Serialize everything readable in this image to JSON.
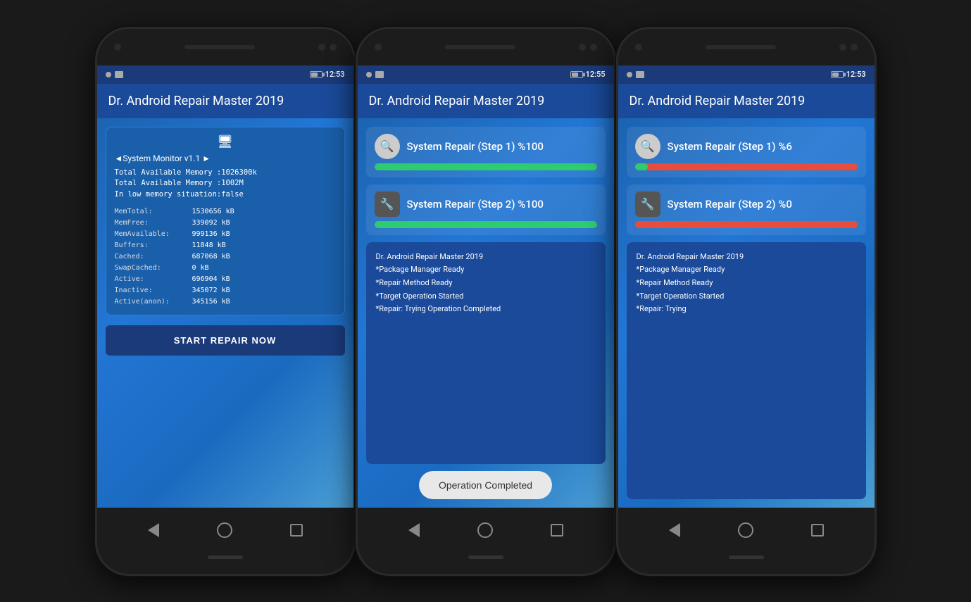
{
  "phones": [
    {
      "id": "phone1",
      "status_bar": {
        "time": "12:53"
      },
      "header": {
        "title": "Dr. Android Repair Master 2019"
      },
      "screen": "monitor",
      "monitor": {
        "nav_label": "◄System Monitor v1.1 ►",
        "summary": [
          "Total Available Memory :1026300k",
          "Total Available Memory :1002M",
          "In low memory situation:false"
        ],
        "rows": [
          {
            "label": "MemTotal:",
            "value": "1530656 kB"
          },
          {
            "label": "MemFree:",
            "value": "339092 kB"
          },
          {
            "label": "MemAvailable:",
            "value": "999136 kB"
          },
          {
            "label": "Buffers:",
            "value": "11848 kB"
          },
          {
            "label": "Cached:",
            "value": "687068 kB"
          },
          {
            "label": "SwapCached:",
            "value": "0 kB"
          },
          {
            "label": "Active:",
            "value": "696904 kB"
          },
          {
            "label": "Inactive:",
            "value": "345072 kB"
          },
          {
            "label": "Active(anon):",
            "value": "345156 kB"
          }
        ],
        "button_label": "START REPAIR NOW"
      }
    },
    {
      "id": "phone2",
      "status_bar": {
        "time": "12:55"
      },
      "header": {
        "title": "Dr. Android Repair Master 2019"
      },
      "screen": "repair_complete",
      "repair": {
        "step1_label": "System Repair (Step 1) %100",
        "step1_progress": 100,
        "step2_label": "System Repair (Step 2) %100",
        "step2_progress": 100,
        "log_title": "Dr. Android Repair Master 2019",
        "log_lines": [
          "*Package Manager Ready",
          "*Repair Method Ready",
          "*Target Operation Started",
          "*Repair: Trying Operation Completed"
        ],
        "operation_completed": "Operation Completed"
      }
    },
    {
      "id": "phone3",
      "status_bar": {
        "time": "12:53"
      },
      "header": {
        "title": "Dr. Android Repair Master 2019"
      },
      "screen": "repair_in_progress",
      "repair": {
        "step1_label": "System Repair (Step 1) %6",
        "step1_progress": 6,
        "step2_label": "System Repair (Step 2) %0",
        "step2_progress": 0,
        "log_title": "Dr. Android Repair Master 2019",
        "log_lines": [
          "*Package Manager Ready",
          "*Repair Method Ready",
          "*Target Operation Started",
          "*Repair: Trying"
        ]
      }
    }
  ]
}
